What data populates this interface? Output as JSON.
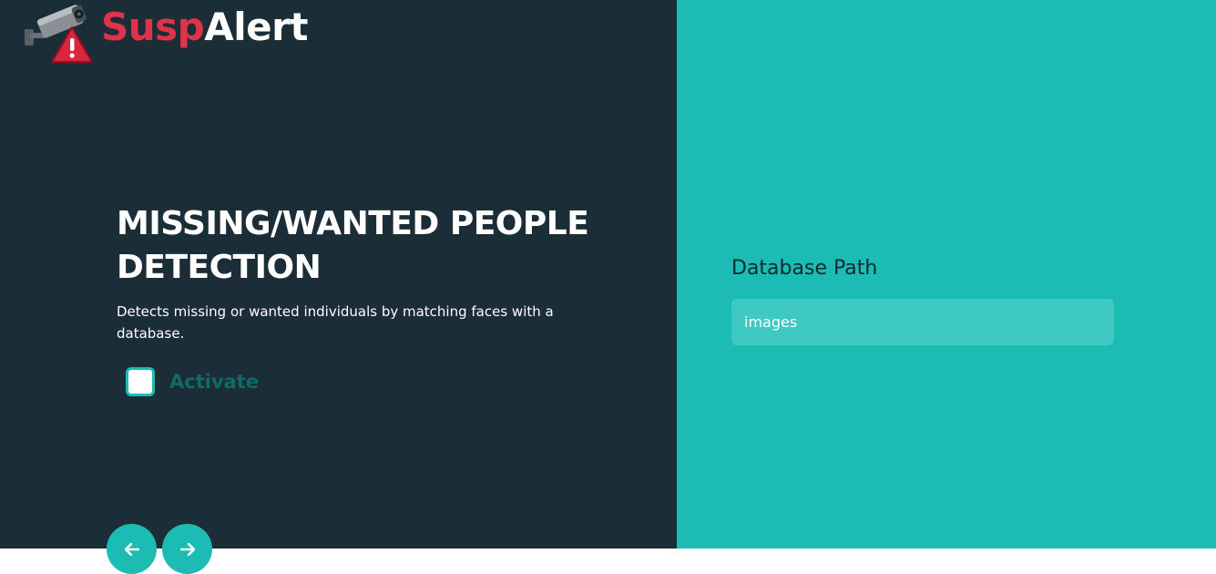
{
  "brand": {
    "name_part1": "Susp",
    "name_part2": "Alert",
    "logo_icon": "security-camera-warning-icon",
    "colors": {
      "part1": "#e0334a",
      "part2": "#ffffff"
    }
  },
  "hero": {
    "title": "MISSING/WANTED PEOPLE DETECTION",
    "description": "Detects missing or wanted individuals by matching faces with a database.",
    "activate_label": "Activate",
    "activate_checked": false
  },
  "settings": {
    "db_path_label": "Database Path",
    "db_path_value": "images"
  },
  "nav": {
    "prev_icon": "arrow-left-icon",
    "next_icon": "arrow-right-icon"
  },
  "colors": {
    "dark_panel": "#1b2d36",
    "accent": "#1cbcb4",
    "input_bg": "#3ec9c2"
  }
}
